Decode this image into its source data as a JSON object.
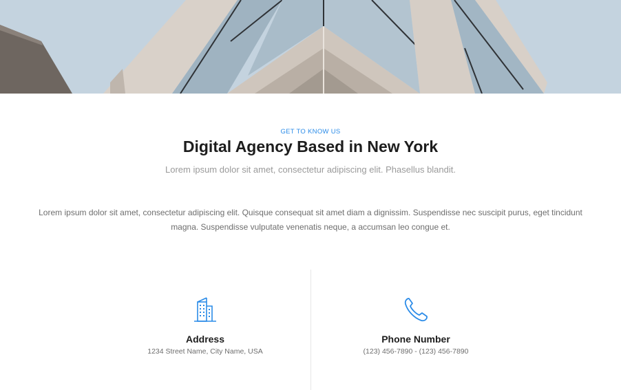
{
  "hero": {
    "image": "building-facade-photo",
    "sky_color": "#c5d4e0"
  },
  "intro": {
    "eyebrow": "GET TO KNOW US",
    "title": "Digital Agency Based in New York",
    "subtitle": "Lorem ipsum dolor sit amet, consectetur adipiscing elit. Phasellus blandit.",
    "body": "Lorem ipsum dolor sit amet, consectetur adipiscing elit. Quisque consequat sit amet diam a dignissim. Suspendisse nec suscipit purus, eget tincidunt magna. Suspendisse vulputate venenatis neque, a accumsan leo congue et."
  },
  "info": [
    {
      "icon": "building-icon",
      "label": "Address",
      "value": "1234 Street Name, City Name, USA"
    },
    {
      "icon": "phone-icon",
      "label": "Phone Number",
      "value": "(123) 456-7890 - (123) 456-7890"
    }
  ],
  "colors": {
    "accent": "#2a8be8",
    "heading": "#1d1d1d",
    "muted": "#9a9a9a",
    "body": "#6d6d6d",
    "divider": "#e6e6e6"
  }
}
